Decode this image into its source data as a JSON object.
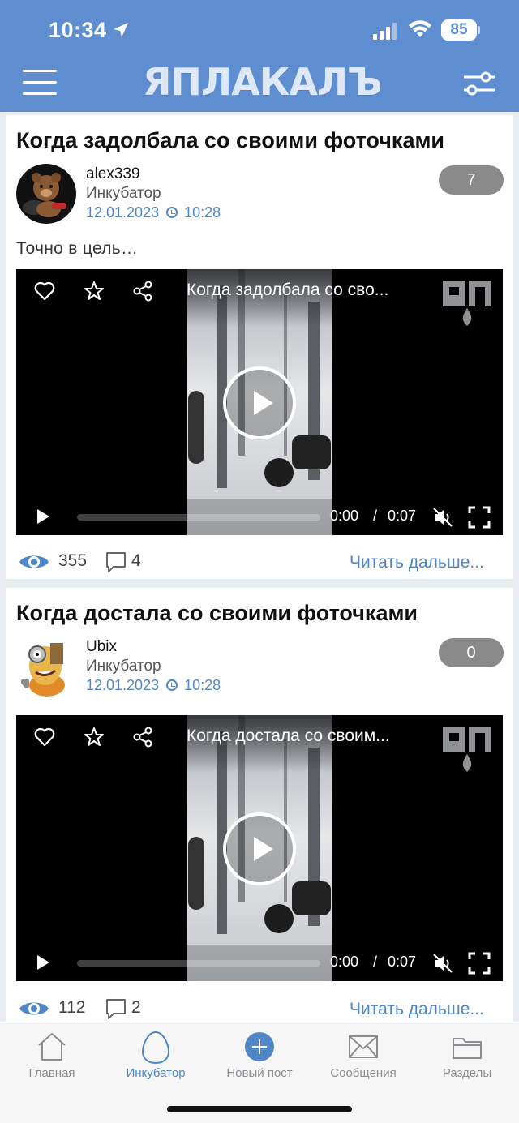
{
  "status_bar": {
    "time": "10:34",
    "battery": "85"
  },
  "header": {
    "logo_text": "ЯПЛАКАЛЪ"
  },
  "posts": [
    {
      "title": "Когда задолбала со своими фоточками",
      "author": "alex339",
      "section": "Инкубатор",
      "date": "12.01.2023",
      "time": "10:28",
      "rating": "7",
      "text": "Точно в цель…",
      "video": {
        "title": "Когда задолбала со сво...",
        "current_time": "0:00",
        "separator": "/",
        "duration": "0:07"
      },
      "views": "355",
      "comments": "4",
      "read_more": "Читать дальше..."
    },
    {
      "title": "Когда достала со своими фоточками",
      "author": "Ubix",
      "section": "Инкубатор",
      "date": "12.01.2023",
      "time": "10:28",
      "rating": "0",
      "video": {
        "title": "Когда достала со своим...",
        "current_time": "0:00",
        "separator": "/",
        "duration": "0:07"
      },
      "views": "112",
      "comments": "2",
      "read_more": "Читать дальше..."
    }
  ],
  "tabs": [
    {
      "label": "Главная",
      "icon": "home-icon",
      "active": false
    },
    {
      "label": "Инкубатор",
      "icon": "egg-icon",
      "active": true
    },
    {
      "label": "Новый пост",
      "icon": "plus-circle-icon",
      "active": false
    },
    {
      "label": "Сообщения",
      "icon": "envelope-icon",
      "active": false
    },
    {
      "label": "Разделы",
      "icon": "folder-icon",
      "active": false
    }
  ],
  "colors": {
    "accent": "#5f8ed0",
    "link": "#4f86c6",
    "rating_bg": "#8a8a8a"
  }
}
